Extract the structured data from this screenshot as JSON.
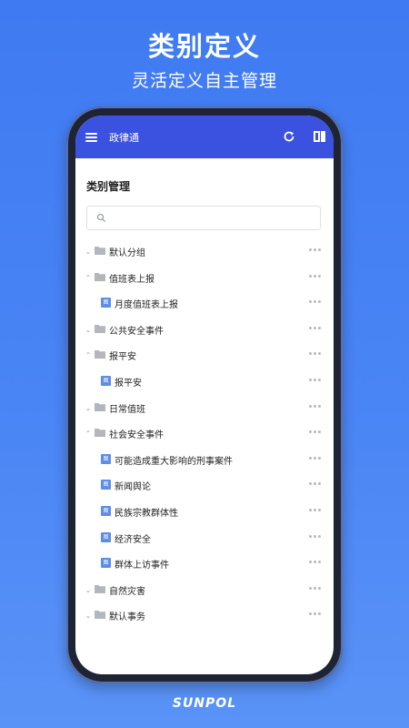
{
  "promo": {
    "headline": "类别定义",
    "subline": "灵活定义自主管理"
  },
  "appbar": {
    "title": "政律通",
    "menu_icon": "hamburger-menu-icon",
    "refresh_icon": "refresh-icon",
    "panel_icon": "sidebar-toggle-icon",
    "color": "#3b52e0"
  },
  "page": {
    "title": "类别管理"
  },
  "search": {
    "placeholder": "",
    "value": ""
  },
  "tree": [
    {
      "label": "默认分组",
      "type": "folder",
      "expanded": false
    },
    {
      "label": "值班表上报",
      "type": "folder",
      "expanded": true
    },
    {
      "label": "月度值班表上报",
      "type": "file"
    },
    {
      "label": "公共安全事件",
      "type": "folder",
      "expanded": false
    },
    {
      "label": "报平安",
      "type": "folder",
      "expanded": true
    },
    {
      "label": "报平安",
      "type": "file"
    },
    {
      "label": "日常值班",
      "type": "folder",
      "expanded": false
    },
    {
      "label": "社会安全事件",
      "type": "folder",
      "expanded": true
    },
    {
      "label": "可能造成重大影响的刑事案件",
      "type": "file"
    },
    {
      "label": "新闻舆论",
      "type": "file"
    },
    {
      "label": "民族宗教群体性",
      "type": "file"
    },
    {
      "label": "经济安全",
      "type": "file"
    },
    {
      "label": "群体上访事件",
      "type": "file"
    },
    {
      "label": "自然灾害",
      "type": "folder",
      "expanded": false
    },
    {
      "label": "默认事务",
      "type": "folder",
      "expanded": false
    }
  ],
  "brand": "SUNPOL"
}
